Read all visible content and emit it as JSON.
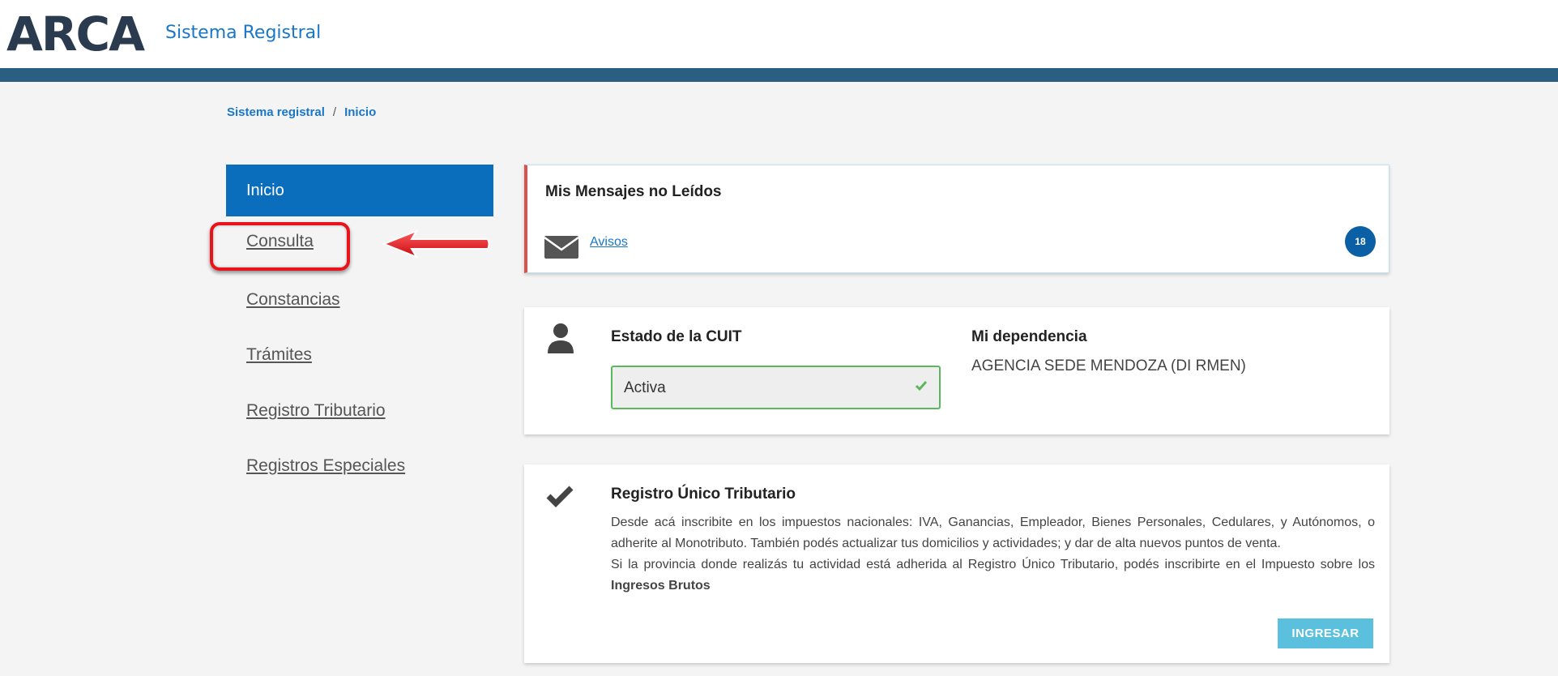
{
  "header": {
    "logo": "ARCA",
    "app_name": "Sistema Registral"
  },
  "breadcrumb": {
    "root": "Sistema registral",
    "separator": "/",
    "current": "Inicio"
  },
  "sidebar": {
    "items": [
      {
        "label": "Inicio",
        "active": true
      },
      {
        "label": "Consulta",
        "highlighted": true
      },
      {
        "label": "Constancias"
      },
      {
        "label": "Trámites"
      },
      {
        "label": "Registro Tributario"
      },
      {
        "label": "Registros Especiales"
      }
    ]
  },
  "messages": {
    "title": "Mis Mensajes no Leídos",
    "link": "Avisos",
    "count": "18",
    "icon": "envelope-icon"
  },
  "cuit": {
    "title": "Estado de la CUIT",
    "status": "Activa",
    "dependency_title": "Mi dependencia",
    "dependency_value": "AGENCIA SEDE MENDOZA (DI RMEN)"
  },
  "rut": {
    "title": "Registro Único Tributario",
    "paragraph1": "Desde acá inscribite en los impuestos nacionales: IVA, Ganancias, Empleador, Bienes Personales, Cedulares, y Autónomos, o adherite al Monotributo. También podés actualizar tus domicilios y actividades; y dar de alta nuevos puntos de venta.",
    "paragraph2_pre": "Si la provincia donde realizás tu actividad está adherida al Registro Único Tributario, podés inscribirte en el Impuesto sobre los ",
    "paragraph2_bold": "Ingresos Brutos",
    "button": "INGRESAR"
  },
  "colors": {
    "primary": "#0b6ebd",
    "header_bar": "#2b5f82",
    "highlight": "#e8141c",
    "success": "#5cb85c",
    "info_button": "#5bc0de"
  }
}
